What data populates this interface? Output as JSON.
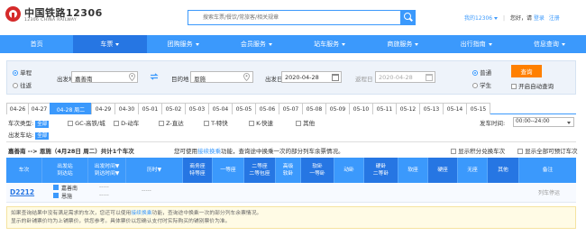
{
  "header": {
    "logo_title": "中国铁路12306",
    "logo_sub": "12306 CHINA RAILWAY",
    "search_placeholder": "搜索车票/餐饮/常旅客/相关规章",
    "my_12306": "我的12306",
    "greeting": "您好，请",
    "login": "登录",
    "register": "注册"
  },
  "nav": {
    "items": [
      "首页",
      "车票",
      "团购服务",
      "会员服务",
      "站车服务",
      "商旅服务",
      "出行指南",
      "信息查询"
    ]
  },
  "query": {
    "trip_oneway": "单程",
    "trip_round": "往返",
    "from_label": "出发地",
    "from_value": "嘉善南",
    "to_label": "目的地",
    "to_value": "恩施",
    "depart_label": "出发日",
    "depart_value": "2020-04-28",
    "return_label": "返程日",
    "return_value": "2020-04-28",
    "type_normal": "普通",
    "type_student": "学生",
    "search_button": "查询",
    "auto_query": "开启自动查询"
  },
  "date_tabs": [
    "04-26",
    "04-27",
    "04-28 周二",
    "04-29",
    "04-30",
    "05-01",
    "05-02",
    "05-03",
    "05-04",
    "05-05",
    "05-06",
    "05-07",
    "05-08",
    "05-09",
    "05-10",
    "05-11",
    "05-12",
    "05-13",
    "05-14",
    "05-15"
  ],
  "filters": {
    "train_type_label": "车次类型:",
    "select_all": "全部",
    "types": [
      "GC-高铁/城",
      "D-动车",
      "Z-直达",
      "T-特快",
      "K-快速",
      "其他"
    ],
    "depart_station_label": "出发车站:",
    "depart_time_label": "发车时间:",
    "depart_time_value": "00:00--24:00"
  },
  "summary": {
    "route": "嘉善南 --> 恩施（4月28日 周二）共计1个车次",
    "tip_prefix": "您可使用",
    "tip_link": "接续换乘",
    "tip_suffix": "功能，查询途中换乘一次的部分列车余票情况。",
    "show_points": "显示积分兑换车次",
    "show_bookable": "显示全部可预订车次"
  },
  "table": {
    "headers": [
      "车次",
      "出发站\n到达站",
      "出发时间▼\n到达时间▼",
      "历时▼",
      "商务座\n特等座",
      "一等座",
      "二等座\n二等包座",
      "高级\n软卧",
      "软卧\n一等卧",
      "动卧",
      "硬卧\n二等卧",
      "软座",
      "硬座",
      "无座",
      "其他",
      "备注"
    ],
    "rows": [
      {
        "train": "D2212",
        "from_station": "嘉善南",
        "to_station": "恩施",
        "depart_time": "-----",
        "arrive_time": "-----",
        "duration": "-----",
        "remark": "列车停运"
      }
    ]
  },
  "notice": {
    "line1_prefix": "如果查询结果中没有满足需求的车次，您还可以使用",
    "line1_link": "接续换乘",
    "line1_suffix": "功能，查询途中换乘一次的部分列车余票情况。",
    "line2": "显示的卧铺票价均为上铺票价，供您参考。具体票价以您确认支付时实际购买的铺别票价为准。"
  },
  "colors": {
    "primary_blue": "#3b99fc",
    "nav_active": "#2676e3",
    "query_orange": "#ff8000",
    "logo_red": "#d52a2a"
  }
}
